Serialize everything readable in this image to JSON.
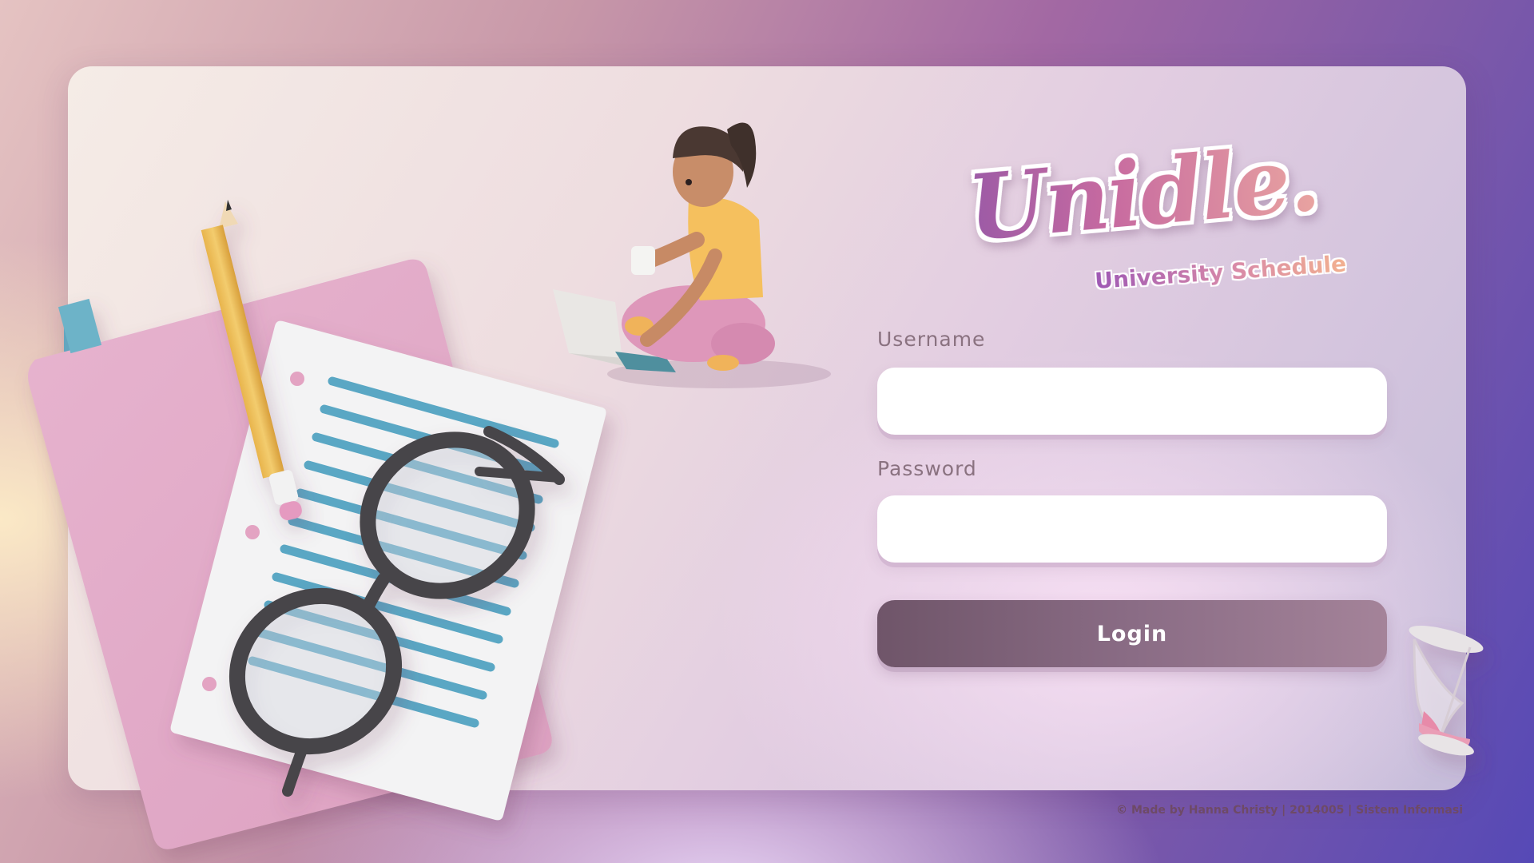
{
  "logo": {
    "title": "Unidle.",
    "subtitle": "University Schedule"
  },
  "form": {
    "username_label": "Username",
    "username_value": "",
    "password_label": "Password",
    "password_value": "",
    "login_label": "Login"
  },
  "footer": {
    "text": "© Made by Hanna Christy | 2014005 |  Sistem Informasi"
  },
  "illustrations": [
    "notebook-illustration",
    "pencil-illustration",
    "paper-illustration",
    "glasses-illustration",
    "student-with-laptop-illustration",
    "hourglass-illustration"
  ],
  "colors": {
    "accent_gradient_start": "#6f5569",
    "accent_gradient_end": "#a48399",
    "label_color": "#8a7280",
    "logo_gradient": [
      "#9b5aa6",
      "#c76aa0",
      "#e9a4a0"
    ]
  }
}
